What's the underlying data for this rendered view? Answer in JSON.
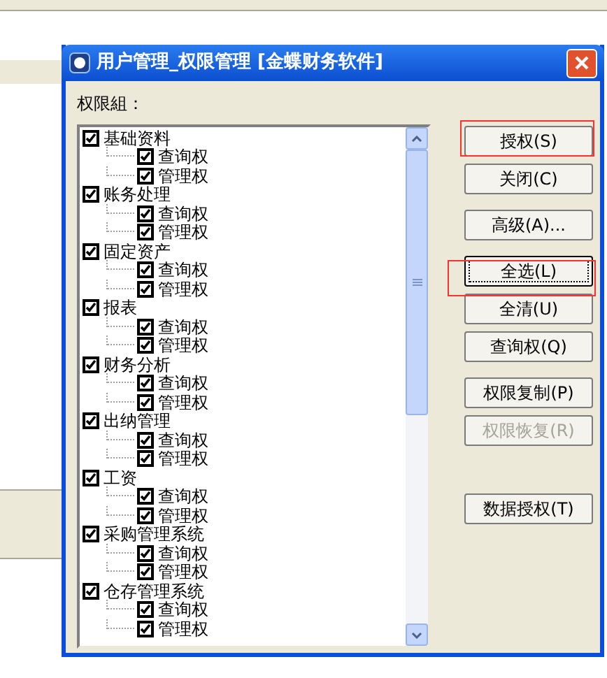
{
  "dialog": {
    "title": "用户管理_权限管理 [金蝶财务软件]",
    "group_label": "权限組：",
    "tree": [
      {
        "label": "基础资料",
        "checked": true,
        "children": [
          {
            "label": "查询权",
            "checked": true
          },
          {
            "label": "管理权",
            "checked": true
          }
        ]
      },
      {
        "label": "账务处理",
        "checked": true,
        "children": [
          {
            "label": "查询权",
            "checked": true
          },
          {
            "label": "管理权",
            "checked": true
          }
        ]
      },
      {
        "label": "固定资产",
        "checked": true,
        "children": [
          {
            "label": "查询权",
            "checked": true
          },
          {
            "label": "管理权",
            "checked": true
          }
        ]
      },
      {
        "label": "报表",
        "checked": true,
        "children": [
          {
            "label": "查询权",
            "checked": true
          },
          {
            "label": "管理权",
            "checked": true
          }
        ]
      },
      {
        "label": "财务分析",
        "checked": true,
        "children": [
          {
            "label": "查询权",
            "checked": true
          },
          {
            "label": "管理权",
            "checked": true
          }
        ]
      },
      {
        "label": "出纳管理",
        "checked": true,
        "children": [
          {
            "label": "查询权",
            "checked": true
          },
          {
            "label": "管理权",
            "checked": true
          }
        ]
      },
      {
        "label": "工资",
        "checked": true,
        "children": [
          {
            "label": "查询权",
            "checked": true
          },
          {
            "label": "管理权",
            "checked": true
          }
        ]
      },
      {
        "label": "采购管理系统",
        "checked": true,
        "children": [
          {
            "label": "查询权",
            "checked": true
          },
          {
            "label": "管理权",
            "checked": true
          }
        ]
      },
      {
        "label": "仓存管理系统",
        "checked": true,
        "children": [
          {
            "label": "查询权",
            "checked": true
          },
          {
            "label": "管理权",
            "checked": true
          }
        ]
      }
    ],
    "button_groups": [
      [
        {
          "label": "授权(S)",
          "disabled": false,
          "focused": false
        },
        {
          "label": "关闭(C)",
          "disabled": false,
          "focused": false
        }
      ],
      [
        {
          "label": "高级(A)...",
          "disabled": false,
          "focused": false
        }
      ],
      [
        {
          "label": "全选(L)",
          "disabled": false,
          "focused": true
        },
        {
          "label": "全清(U)",
          "disabled": false,
          "focused": false
        },
        {
          "label": "查询权(Q)",
          "disabled": false,
          "focused": false
        }
      ],
      [
        {
          "label": "权限复制(P)",
          "disabled": false,
          "focused": false
        },
        {
          "label": "权限恢复(R)",
          "disabled": true,
          "focused": false
        }
      ],
      [
        {
          "label": "数据授权(T)",
          "disabled": false,
          "focused": false
        }
      ]
    ]
  }
}
